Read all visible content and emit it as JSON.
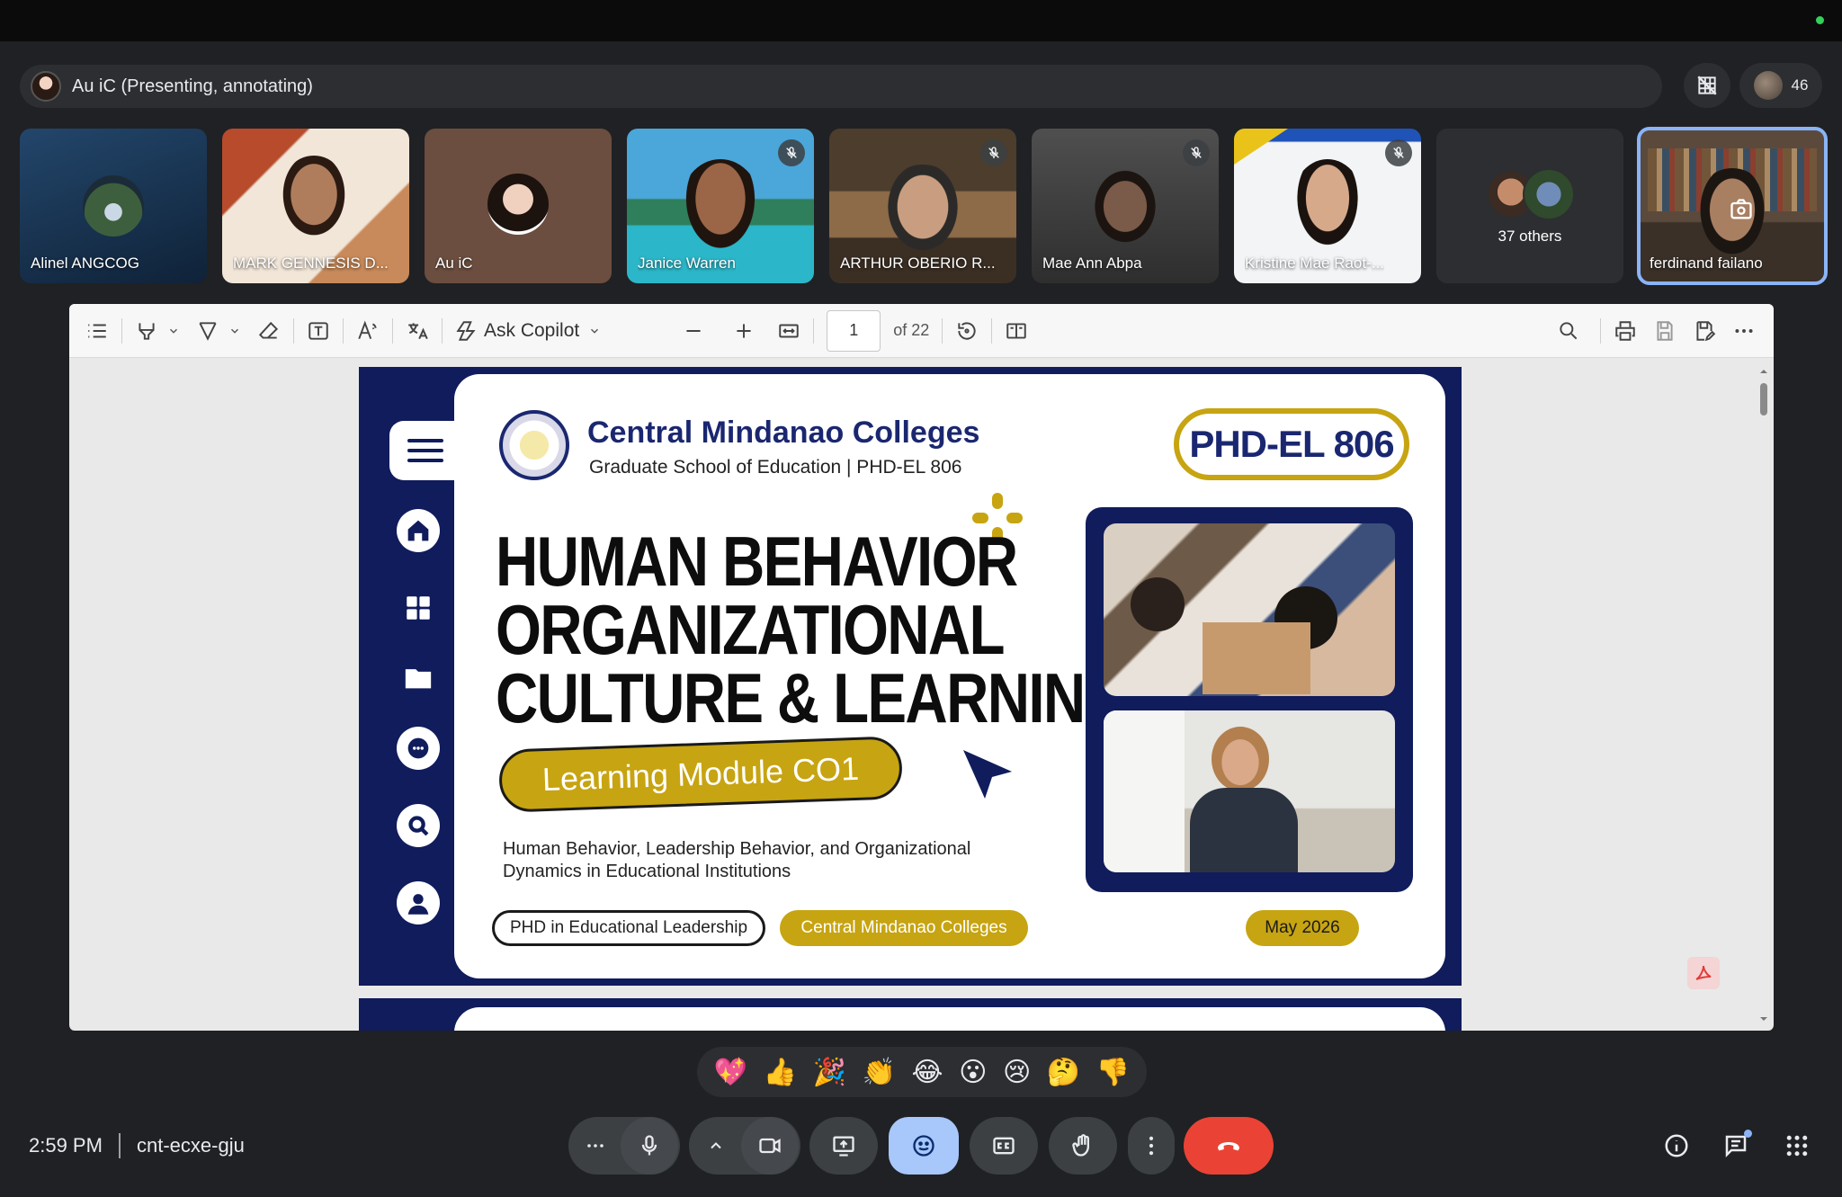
{
  "meeting": {
    "presenter_text": "Au iC (Presenting, annotating)",
    "participant_count": "46",
    "time": "2:59 PM",
    "code": "cnt-ecxe-gju"
  },
  "participants": [
    {
      "name": "Alinel ANGCOG",
      "muted": false
    },
    {
      "name": "MARK GENNESIS D...",
      "muted": false
    },
    {
      "name": "Au iC",
      "muted": false
    },
    {
      "name": "Janice Warren",
      "muted": true
    },
    {
      "name": "ARTHUR OBERIO R...",
      "muted": true
    },
    {
      "name": "Mae Ann Abpa",
      "muted": true
    },
    {
      "name": "Kristine Mae Raot-...",
      "muted": true
    },
    {
      "name": "37 others",
      "muted": false
    },
    {
      "name": "ferdinand failano",
      "muted": false
    }
  ],
  "pdf_toolbar": {
    "copilot_label": "Ask Copilot",
    "page_number": "1",
    "page_total": "of 22"
  },
  "slide": {
    "school_name": "Central Mindanao Colleges",
    "school_sub": "Graduate School of Education | PHD-EL 806",
    "course_code": "PHD-EL 806",
    "headline_1": "HUMAN BEHAVIOR",
    "headline_2": "ORGANIZATIONAL",
    "headline_3": "CULTURE & LEARNING",
    "module_label": "Learning Module CO1",
    "description": "Human Behavior, Leadership Behavior, and Organizational Dynamics in Educational Institutions",
    "chip_program": "PHD in Educational Leadership",
    "chip_school": "Central Mindanao Colleges",
    "chip_date": "May 2026"
  },
  "reactions": [
    "💖",
    "👍",
    "🎉",
    "👏",
    "😂",
    "😮",
    "😢",
    "🤔",
    "👎"
  ],
  "colors": {
    "slide_navy": "#101c5c",
    "slide_gold": "#c7a411",
    "meet_bg": "#202124",
    "end_call_red": "#ea4335",
    "active_blue": "#8ab4f8"
  }
}
